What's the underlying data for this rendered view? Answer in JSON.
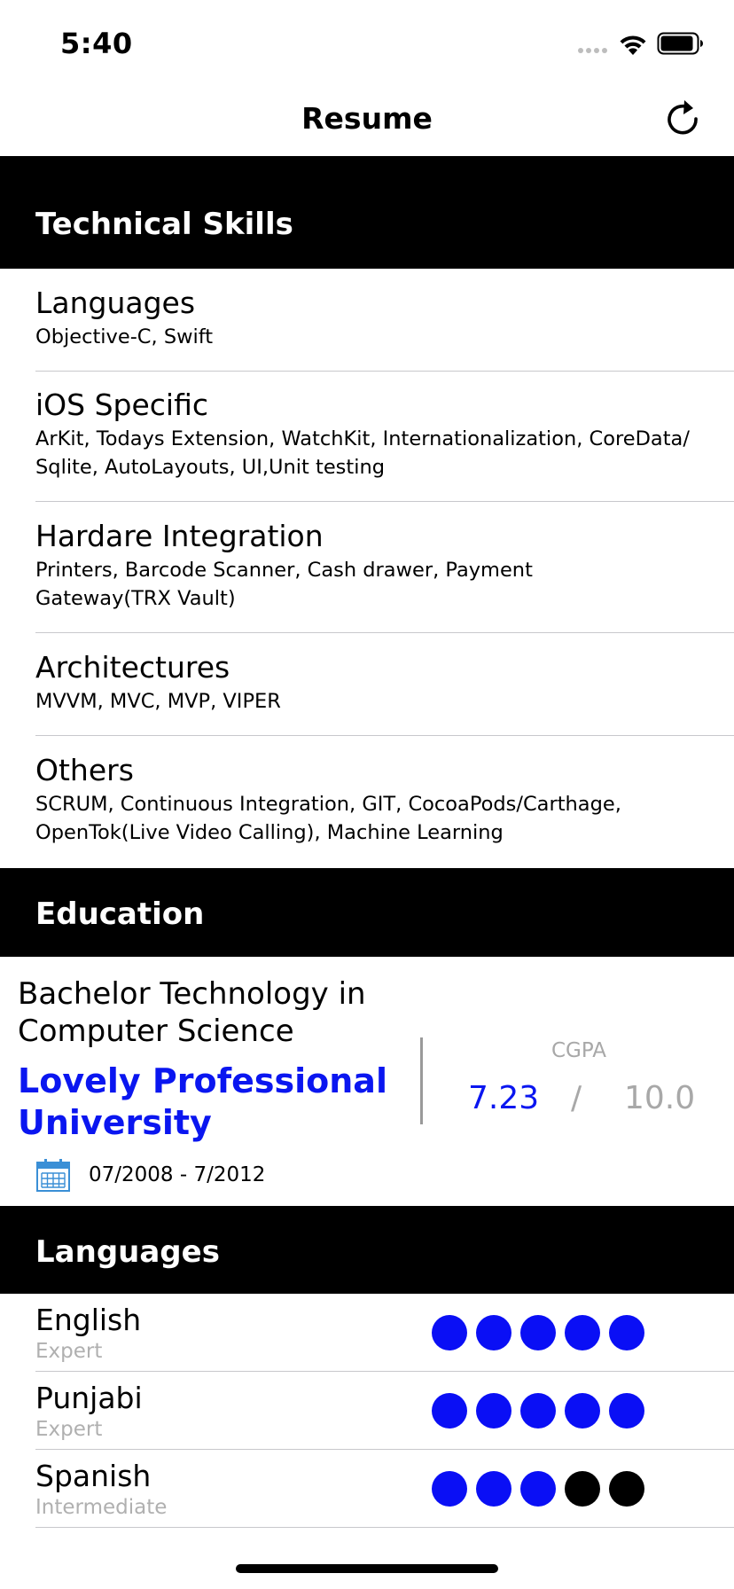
{
  "status_bar": {
    "time": "5:40"
  },
  "nav": {
    "title": "Resume",
    "refresh_icon": "refresh-icon"
  },
  "technical_skills": {
    "header": "Technical Skills",
    "items": [
      {
        "title": "Languages",
        "desc": "Objective-C, Swift"
      },
      {
        "title": "iOS Specific",
        "desc": "ArKit, Todays Extension, WatchKit, Internationalization, CoreData/ Sqlite, AutoLayouts, UI,Unit testing"
      },
      {
        "title": "Hardare Integration",
        "desc": "Printers, Barcode Scanner, Cash drawer, Payment Gateway(TRX Vault)"
      },
      {
        "title": "Architectures",
        "desc": "MVVM, MVC, MVP, VIPER"
      },
      {
        "title": "Others",
        "desc": "SCRUM, Continuous Integration, GIT, CocoaPods/Carthage, OpenTok(Live Video Calling), Machine Learning"
      }
    ]
  },
  "education": {
    "header": "Education",
    "degree": "Bachelor Technology in Computer Science",
    "university": "Lovely Professional University",
    "dates": "07/2008 - 7/2012",
    "cgpa_label": "CGPA",
    "cgpa_value": "7.23",
    "cgpa_separator": "/",
    "cgpa_max": "10.0",
    "colors": {
      "accent": "#0a16f0"
    }
  },
  "languages": {
    "header": "Languages",
    "items": [
      {
        "name": "English",
        "level": "Expert",
        "rating": 5,
        "max": 5
      },
      {
        "name": "Punjabi",
        "level": "Expert",
        "rating": 5,
        "max": 5
      },
      {
        "name": "Spanish",
        "level": "Intermediate",
        "rating": 3,
        "max": 5
      }
    ]
  }
}
